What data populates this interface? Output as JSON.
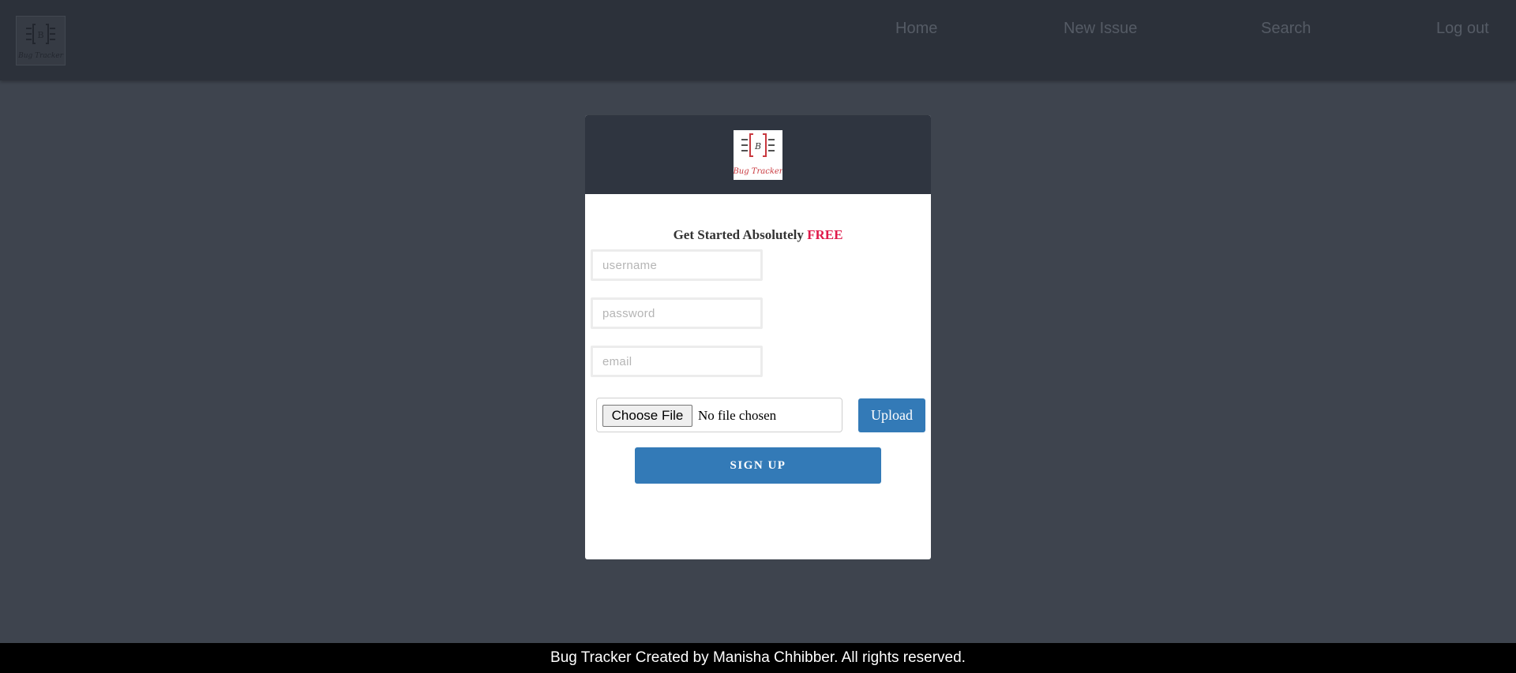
{
  "navbar": {
    "logo_icon": "bug-tracker-logo-icon",
    "links": {
      "home": "Home",
      "new_issue": "New Issue",
      "search": "Search",
      "logout": "Log out"
    }
  },
  "signup": {
    "logo_icon": "bug-tracker-logo-icon",
    "heading_prefix": "Get Started Absolutely",
    "heading_highlight": "FREE",
    "username": {
      "placeholder": "username",
      "value": ""
    },
    "password": {
      "placeholder": "password",
      "value": ""
    },
    "email": {
      "placeholder": "email",
      "value": ""
    },
    "file": {
      "choose_label": "Choose File",
      "status": "No file chosen"
    },
    "upload_label": "Upload",
    "submit_label": "SIGN UP"
  },
  "footer": {
    "text": "Bug Tracker Created by Manisha Chhibber. All rights reserved."
  },
  "colors": {
    "page_background": "#3e444e",
    "navbar_background": "#2c313a",
    "card_header": "#2f3540",
    "primary_button": "#337ab7",
    "highlight": "#e0194a",
    "footer_background": "#000000"
  }
}
